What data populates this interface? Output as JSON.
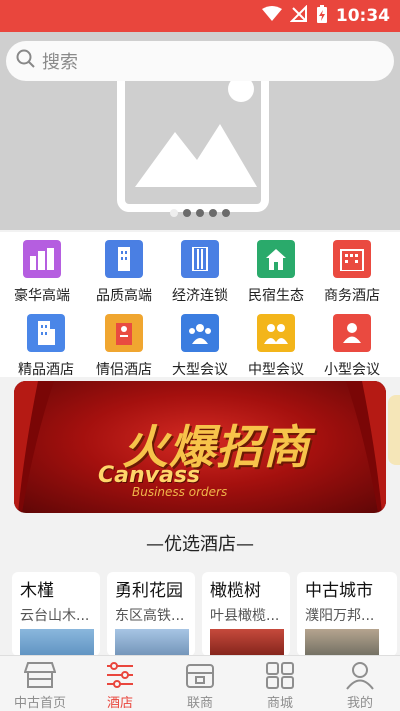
{
  "status_bar": {
    "time": "10:34"
  },
  "search": {
    "placeholder": "搜索"
  },
  "banner": {
    "dot_count": 4,
    "active_dot": 0
  },
  "categories": [
    {
      "label": "豪华高端",
      "icon": "city-skyline-icon",
      "color": "#b55ee0"
    },
    {
      "label": "品质高端",
      "icon": "building-icon",
      "color": "#4a7fe3"
    },
    {
      "label": "经济连锁",
      "icon": "tower-icon",
      "color": "#4a7fe3"
    },
    {
      "label": "民宿生态",
      "icon": "house-icon",
      "color": "#2aaa6b"
    },
    {
      "label": "商务酒店",
      "icon": "hotel-icon",
      "color": "#ea4a40"
    },
    {
      "label": "精品酒店",
      "icon": "office-building-icon",
      "color": "#4a86e8"
    },
    {
      "label": "情侣酒店",
      "icon": "couple-hotel-icon",
      "color": "#f0a630"
    },
    {
      "label": "大型会议",
      "icon": "large-meeting-icon",
      "color": "#3b7de0"
    },
    {
      "label": "中型会议",
      "icon": "medium-meeting-icon",
      "color": "#f3b51a"
    },
    {
      "label": "小型会议",
      "icon": "small-meeting-icon",
      "color": "#ea4a40"
    }
  ],
  "promo": {
    "title_cn": "火爆招商",
    "title_en": "Canvass",
    "subtitle_en": "Business orders"
  },
  "section": {
    "title": "—优选酒店—"
  },
  "hotels": [
    {
      "name": "木槿",
      "addr": "云台山木..."
    },
    {
      "name": "勇利花园",
      "addr": "东区高铁..."
    },
    {
      "name": "橄榄树",
      "addr": "叶县橄榄..."
    },
    {
      "name": "中古城市",
      "addr": "濮阳万邦..."
    }
  ],
  "nav": [
    {
      "label": "中古首页",
      "icon": "store-icon",
      "active": false
    },
    {
      "label": "酒店",
      "icon": "sliders-icon",
      "active": true
    },
    {
      "label": "联商",
      "icon": "shop-icon",
      "active": false
    },
    {
      "label": "商城",
      "icon": "grid-apps-icon",
      "active": false
    },
    {
      "label": "我的",
      "icon": "person-icon",
      "active": false
    }
  ],
  "colors": {
    "accent": "#e9463d",
    "inactive_nav": "#8e8e8e"
  }
}
